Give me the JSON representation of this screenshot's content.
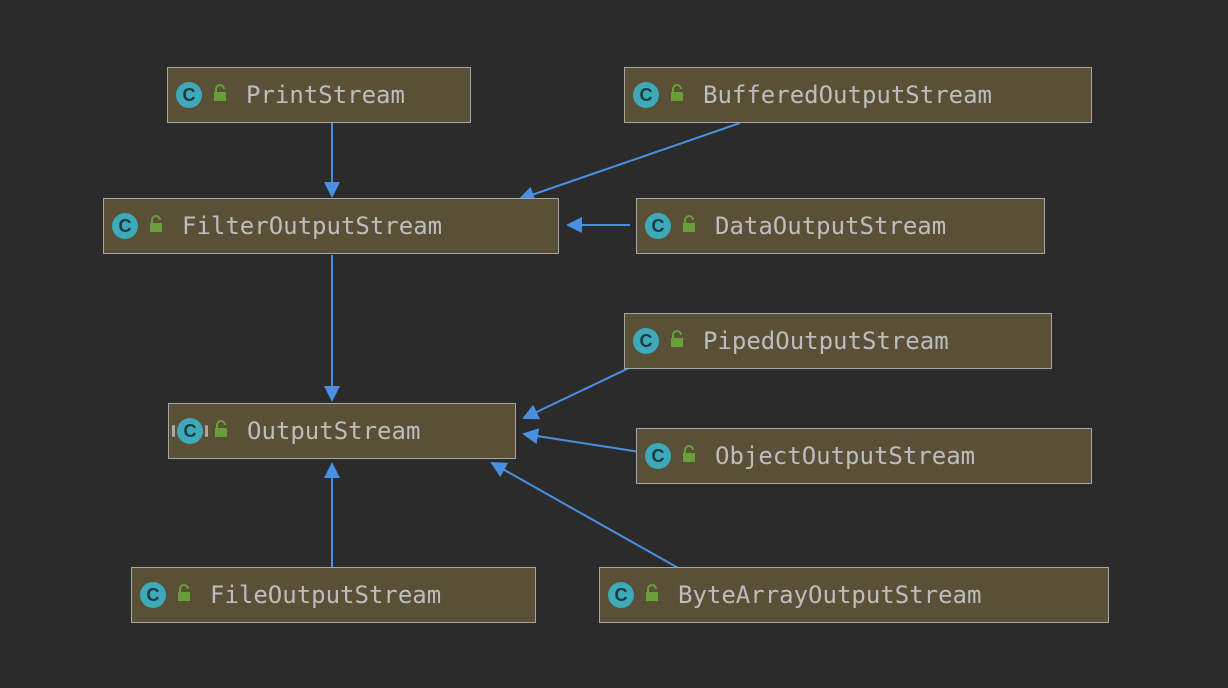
{
  "nodes": {
    "print_stream": {
      "label": "PrintStream",
      "abstract": false
    },
    "buffered_output_stream": {
      "label": "BufferedOutputStream",
      "abstract": false
    },
    "filter_output_stream": {
      "label": "FilterOutputStream",
      "abstract": false
    },
    "data_output_stream": {
      "label": "DataOutputStream",
      "abstract": false
    },
    "piped_output_stream": {
      "label": "PipedOutputStream",
      "abstract": false
    },
    "output_stream": {
      "label": "OutputStream",
      "abstract": true
    },
    "object_output_stream": {
      "label": "ObjectOutputStream",
      "abstract": false
    },
    "file_output_stream": {
      "label": "FileOutputStream",
      "abstract": false
    },
    "bytearray_output_stream": {
      "label": "ByteArrayOutputStream",
      "abstract": false
    }
  },
  "edges": [
    {
      "from": "print_stream",
      "to": "filter_output_stream"
    },
    {
      "from": "buffered_output_stream",
      "to": "filter_output_stream"
    },
    {
      "from": "data_output_stream",
      "to": "filter_output_stream"
    },
    {
      "from": "filter_output_stream",
      "to": "output_stream"
    },
    {
      "from": "piped_output_stream",
      "to": "output_stream"
    },
    {
      "from": "object_output_stream",
      "to": "output_stream"
    },
    {
      "from": "bytearray_output_stream",
      "to": "output_stream"
    },
    {
      "from": "file_output_stream",
      "to": "output_stream"
    }
  ],
  "colors": {
    "edge": "#4a90e2",
    "node_bg": "#595037",
    "node_border": "#a6a6a6",
    "text": "#bdbdbd",
    "class_icon_bg": "#3ea9b8",
    "lock_icon": "#6a9e3a"
  }
}
